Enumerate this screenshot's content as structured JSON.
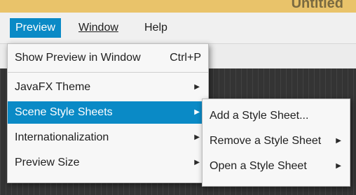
{
  "window": {
    "title_fragment": "Untitled"
  },
  "menubar": {
    "items": [
      {
        "label": "Preview"
      },
      {
        "label": "Window"
      },
      {
        "label": "Help"
      }
    ]
  },
  "preview_menu": {
    "items": [
      {
        "label": "Show Preview in Window",
        "shortcut": "Ctrl+P"
      },
      {
        "label": "JavaFX Theme",
        "arrow": "▶"
      },
      {
        "label": "Scene Style Sheets",
        "arrow": "▶"
      },
      {
        "label": "Internationalization",
        "arrow": "▶"
      },
      {
        "label": "Preview Size",
        "arrow": "▶"
      }
    ]
  },
  "style_sheet_submenu": {
    "items": [
      {
        "label": "Add a Style Sheet..."
      },
      {
        "label": "Remove a Style Sheet",
        "arrow": "▶"
      },
      {
        "label": "Open a Style Sheet",
        "arrow": "▶"
      }
    ]
  },
  "colors": {
    "accent": "#0a8ac6",
    "menu_bg": "#f7f7f7",
    "title_strip": "#e9c36a"
  }
}
